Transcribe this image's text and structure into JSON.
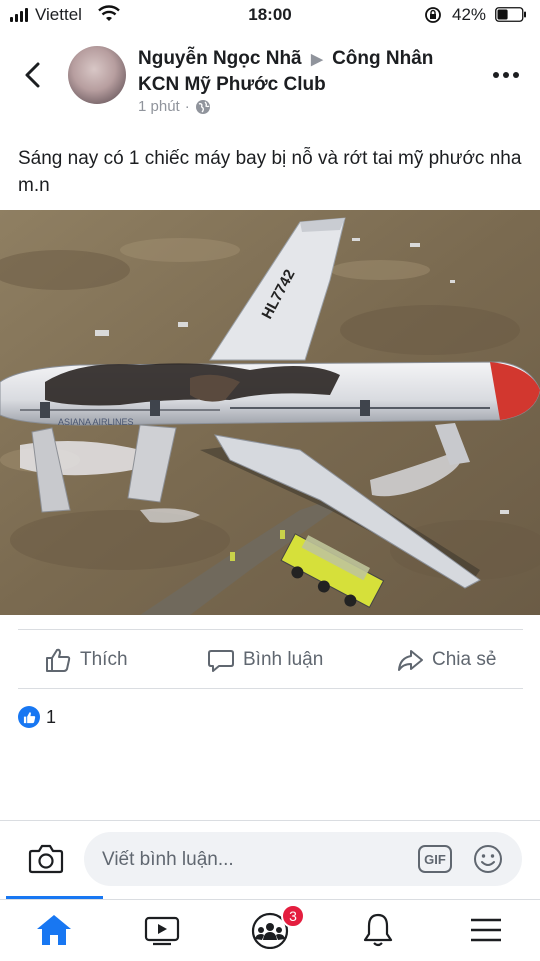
{
  "status_bar": {
    "carrier": "Viettel",
    "time": "18:00",
    "battery_percent": "42%",
    "battery_level": 0.42
  },
  "post": {
    "author": "Nguyễn Ngọc Nhã",
    "group": "Công Nhân KCN Mỹ Phước Club",
    "timestamp": "1 phút",
    "separator": "·",
    "audience_icon": "globe-icon",
    "text": "Sáng nay có 1 chiếc máy bay bị nỗ  và rớt tai mỹ phước nha m.n",
    "photo_text": "HL7742",
    "photo_livery_text": "ASIANA AIRLINES"
  },
  "actions": {
    "like": "Thích",
    "comment": "Bình luận",
    "share": "Chia sẻ"
  },
  "reactions": {
    "count": "1"
  },
  "composer": {
    "placeholder": "Viết bình luận...",
    "gif_label": "GIF"
  },
  "nav": {
    "items": [
      "home-icon",
      "watch-icon",
      "groups-icon",
      "notifications-icon",
      "menu-icon"
    ],
    "groups_badge": "3"
  },
  "colors": {
    "accent": "#1877f2",
    "badge": "#e41e3f",
    "muted": "#606770"
  }
}
